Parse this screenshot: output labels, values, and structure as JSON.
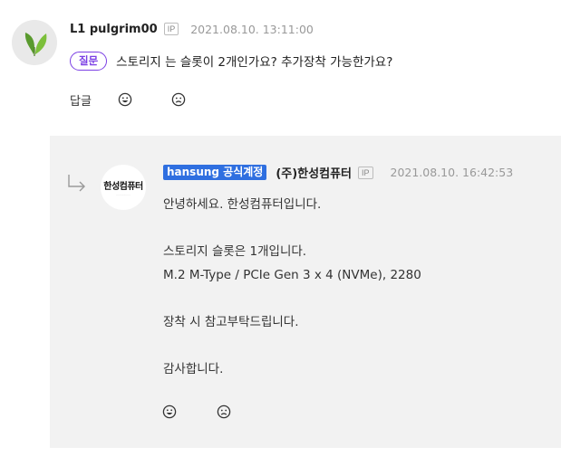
{
  "question": {
    "username": "L1 pulgrim00",
    "ip_label": "IP",
    "timestamp": "2021.08.10. 13:11:00",
    "tag": "질문",
    "text": "스토리지 는 슬롯이 2개인가요? 추가장착 가능한가요?",
    "reply_label": "답글",
    "like_icon": "smile-icon",
    "dislike_icon": "frown-icon"
  },
  "reply": {
    "badge": "hansung 공식계정",
    "company_name": "(주)한성컴퓨터",
    "ip_label": "IP",
    "timestamp": "2021.08.10. 16:42:53",
    "avatar_logo": "한성컴퓨터",
    "lines": [
      "안녕하세요. 한성컴퓨터입니다.",
      "",
      "스토리지 슬롯은 1개입니다.",
      "M.2 M-Type / PCIe Gen 3 x 4 (NVMe), 2280",
      "",
      "장착 시 참고부탁드립니다.",
      "",
      "감사합니다."
    ],
    "like_icon": "smile-icon",
    "dislike_icon": "frown-icon"
  },
  "colors": {
    "tag_purple": "#7b3fe4",
    "badge_blue": "#2f6fe0",
    "reply_bg": "#f2f2f2"
  }
}
